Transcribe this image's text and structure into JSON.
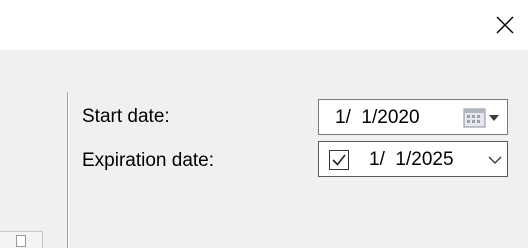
{
  "window": {
    "close_icon": "close-icon"
  },
  "dates": {
    "start": {
      "label": "Start date:",
      "value": "1/  1/2020",
      "picker_icon": "calendar-icon"
    },
    "expiration": {
      "label": "Expiration date:",
      "value": "1/  1/2025",
      "checked": true,
      "dropdown_icon": "chevron-down-icon"
    }
  }
}
